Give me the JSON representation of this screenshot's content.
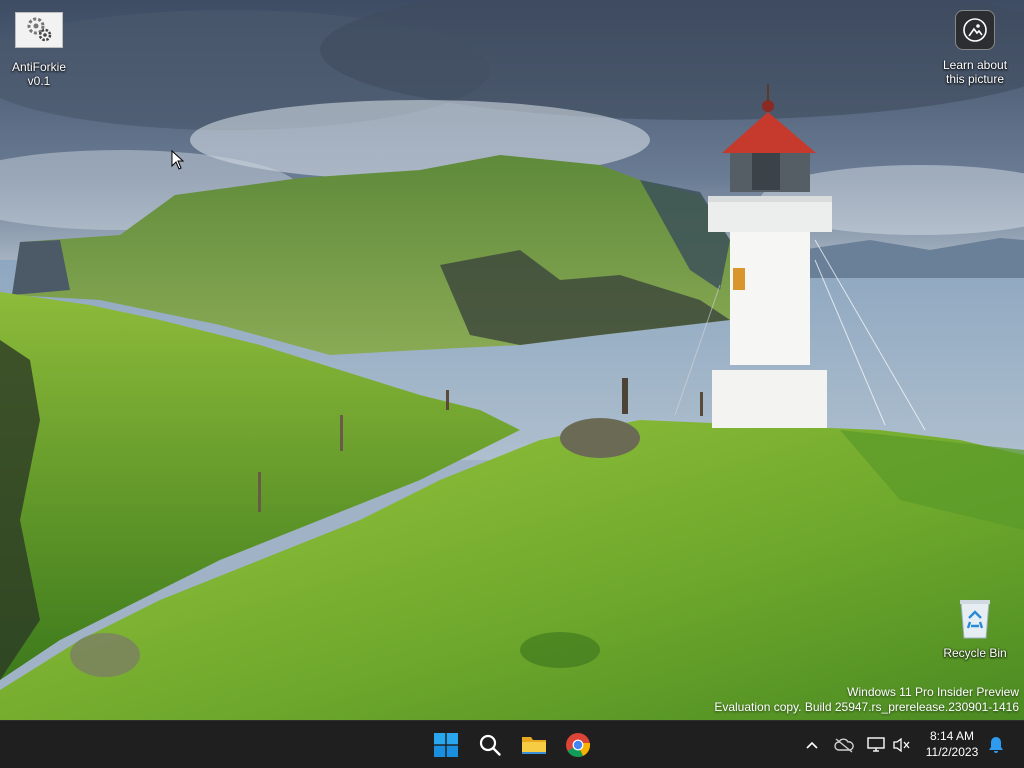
{
  "desktop": {
    "icons": [
      {
        "name": "antiforkie-icon",
        "label_line1": "AntiForkie",
        "label_line2": "v0.1"
      },
      {
        "name": "learn-about-picture-icon",
        "label_line1": "Learn about",
        "label_line2": "this picture"
      },
      {
        "name": "recycle-bin-icon",
        "label": "Recycle Bin"
      }
    ],
    "watermark": {
      "line1": "Windows 11 Pro Insider Preview",
      "line2": "Evaluation copy. Build 25947.rs_prerelease.230901-1416"
    }
  },
  "taskbar": {
    "apps": [
      {
        "icon": "windows-start-icon"
      },
      {
        "icon": "search-icon"
      },
      {
        "icon": "file-explorer-icon"
      },
      {
        "icon": "chrome-icon"
      }
    ],
    "tray": [
      {
        "icon": "chevron-up-icon"
      },
      {
        "icon": "onedrive-offline-icon"
      },
      {
        "icon": "network-icon"
      },
      {
        "icon": "volume-muted-icon"
      },
      {
        "icon": "bell-icon"
      }
    ],
    "clock": {
      "time": "8:14 AM",
      "date": "11/2/2023"
    }
  },
  "colors": {
    "accent": "#0078d4",
    "taskbar_bg": "#1f1f1f",
    "chrome_red": "#db4437"
  }
}
